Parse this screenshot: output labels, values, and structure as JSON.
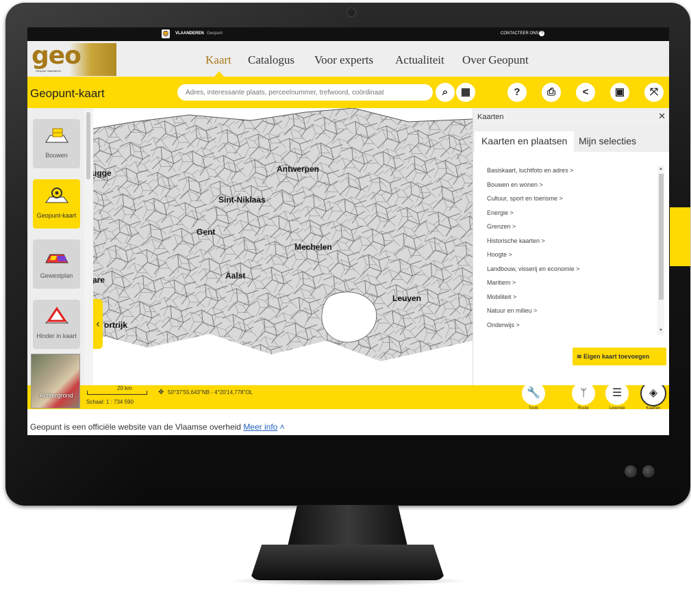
{
  "gov_bar": {
    "brand": "VLAANDEREN",
    "site": "Geopunt",
    "contact": "CONTACTEER ONS"
  },
  "header": {
    "logo_text": "geo",
    "logo_sub": "Geopunt Vlaanderen",
    "nav": [
      "Kaart",
      "Catalogus",
      "Voor experts",
      "Actualiteit",
      "Over Geopunt"
    ],
    "active_nav": "Kaart"
  },
  "toolbar": {
    "title": "Geopunt-kaart",
    "search_placeholder": "Adres, interessante plaats, perceelnummer, trefwoord, coördinaat",
    "icons": [
      "search-icon",
      "grid-icon",
      "help-icon",
      "print-icon",
      "share-icon",
      "window-icon",
      "fullscreen-icon"
    ]
  },
  "left_panel": {
    "items": [
      {
        "label": "Bouwen",
        "icon": "building-icon"
      },
      {
        "label": "Geopunt-kaart",
        "icon": "pin-icon"
      },
      {
        "label": "Gewestplan",
        "icon": "plan-icon"
      },
      {
        "label": "Hinder in kaart",
        "icon": "warning-icon"
      }
    ],
    "background_label": "Achtergrond"
  },
  "map": {
    "cities": [
      "Antwerpen",
      "ugge",
      "Sint-Niklaas",
      "Gent",
      "Mechelen",
      "Aalst",
      "Leuven",
      "are",
      "ortrijk"
    ]
  },
  "status": {
    "scale_text": "20 km",
    "schaal": "Schaal: 1 : 734 590",
    "coordinate": "50°37'55,643\"NB - 4°20'14,778\"OL"
  },
  "right_panel": {
    "title": "Kaarten",
    "tabs": [
      "Kaarten en plaatsen",
      "Mijn selecties"
    ],
    "list": [
      "Basiskaart, luchtfoto en adres >",
      "Bouwen en wonen >",
      "Cultuur, sport en toerisme >",
      "Energie >",
      "Grenzen >",
      "Historische kaarten >",
      "Hoogte >",
      "Landbouw, visserij en economie >",
      "Maritiem >",
      "Mobiliteit >",
      "Natuur en milieu >",
      "Onderwijs >"
    ],
    "add_button": "Eigen kaart toevoegen"
  },
  "tools": [
    {
      "label": "Tools",
      "icon": "wrench-icon"
    },
    {
      "label": "Route",
      "icon": "route-icon"
    },
    {
      "label": "Legende",
      "icon": "list-icon"
    },
    {
      "label": "Kaarten",
      "icon": "layers-icon"
    }
  ],
  "footer": {
    "text": "Geopunt is een officiële website van de Vlaamse overheid",
    "link": "Meer info"
  },
  "colors": {
    "accent": "#fed902",
    "brand_gold": "#a7791a"
  }
}
